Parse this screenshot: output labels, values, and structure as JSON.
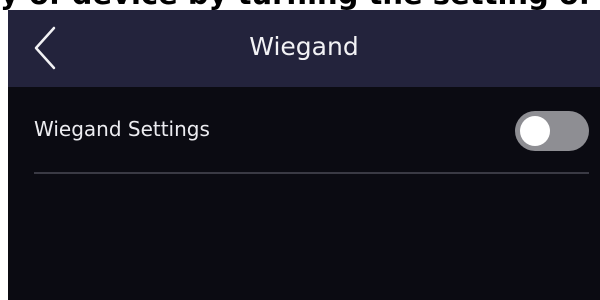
{
  "top_strip_text": "y of device by turning the setting of Wiegand",
  "header": {
    "title": "Wiegand",
    "back_icon": "chevron-left-icon"
  },
  "settings": {
    "wiegand_settings": {
      "label": "Wiegand Settings",
      "enabled": false
    }
  },
  "colors": {
    "header_bg": "#23233c",
    "screen_bg": "#0b0b12",
    "toggle_off": "#8e8e93",
    "text": "#f2f2f5"
  }
}
